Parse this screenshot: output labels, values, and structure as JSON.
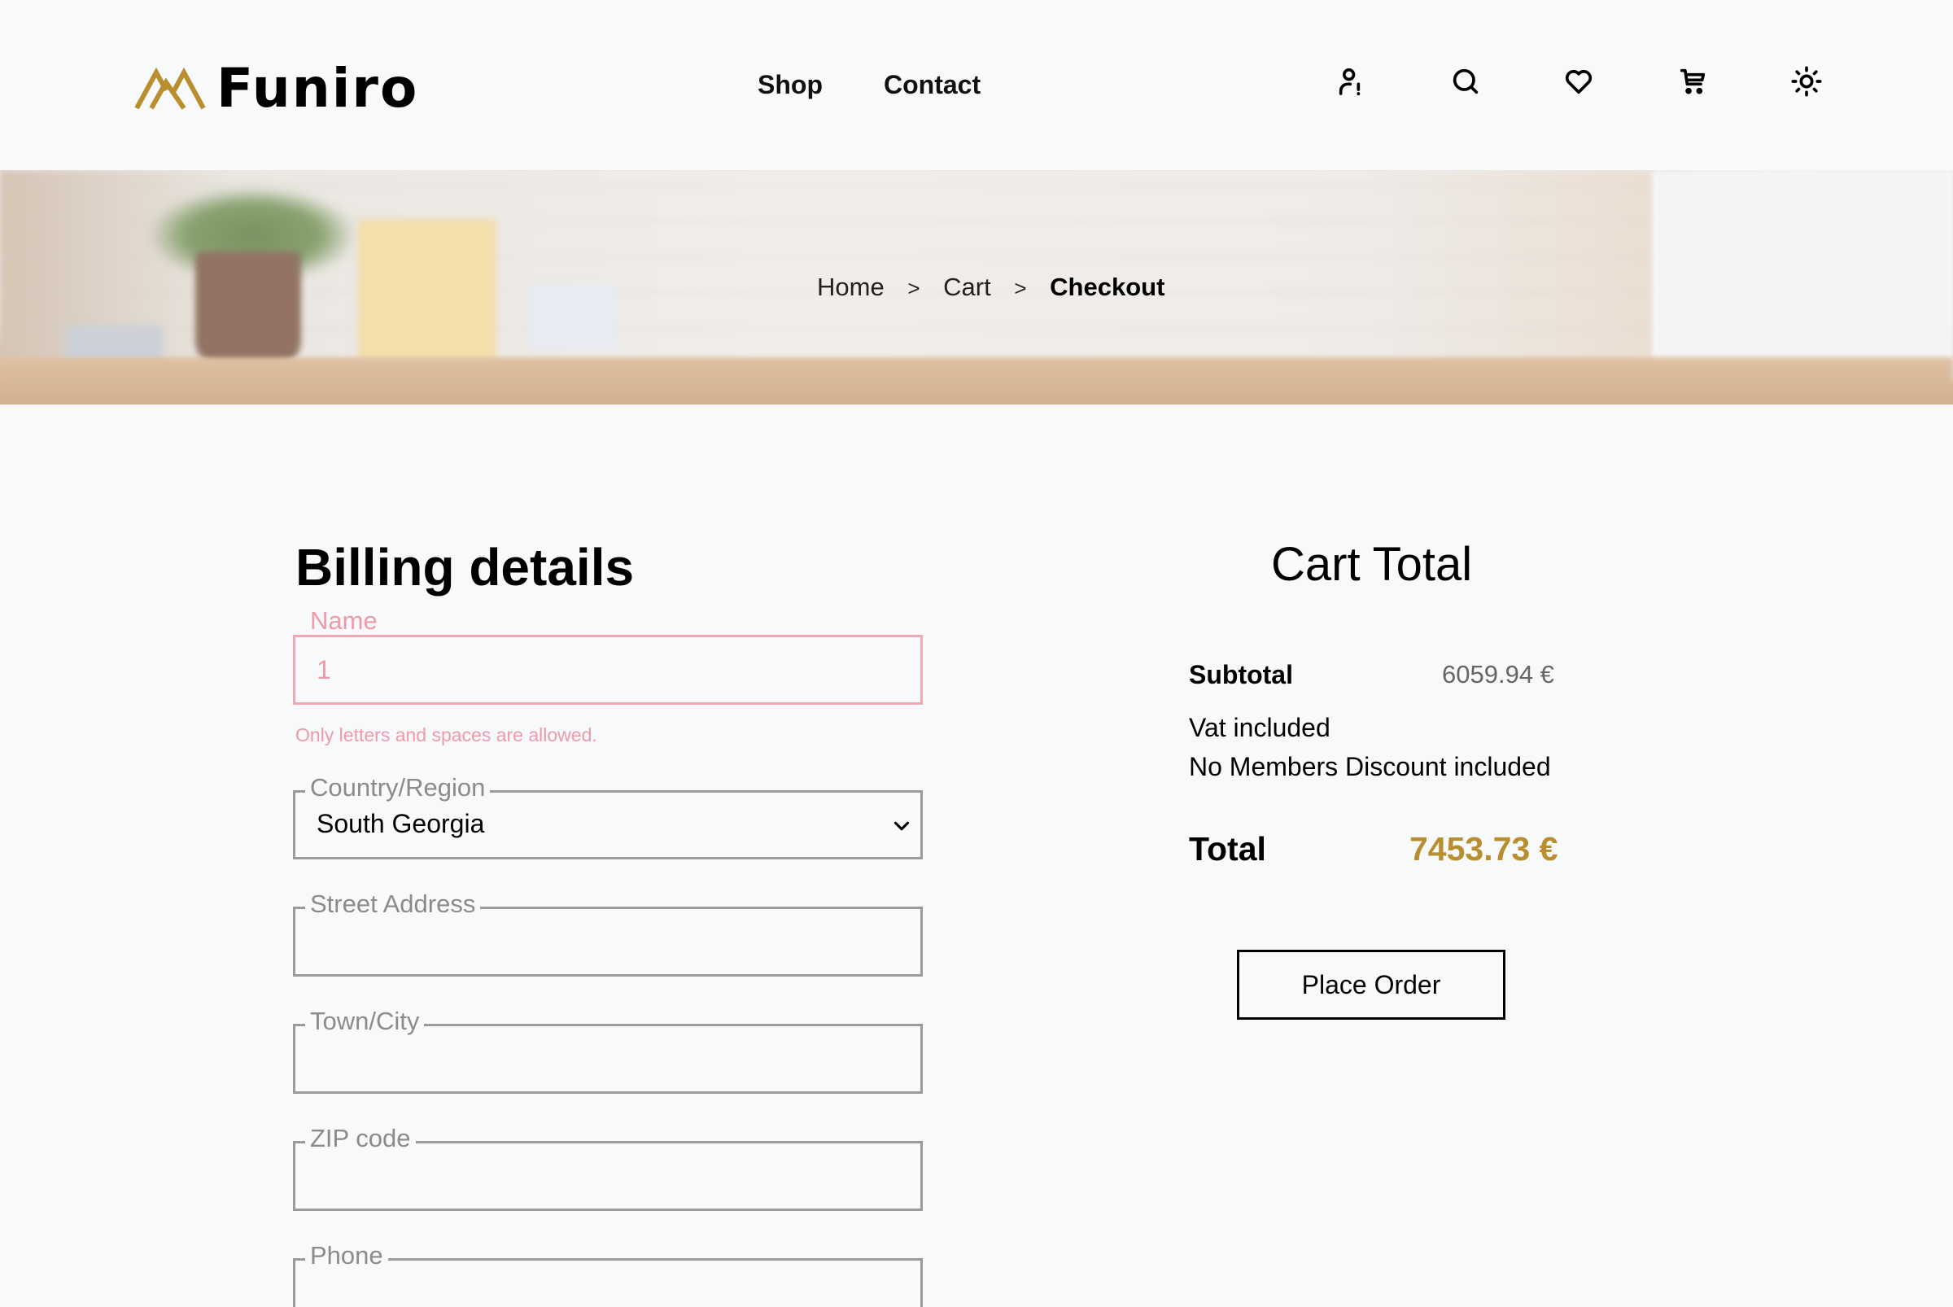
{
  "brand": {
    "name": "Funiro",
    "logo_color": "#b88e2f"
  },
  "nav": {
    "shop": "Shop",
    "contact": "Contact"
  },
  "header_icons": [
    "user-alert-icon",
    "search-icon",
    "heart-icon",
    "cart-icon",
    "sun-icon"
  ],
  "breadcrumb": {
    "home": "Home",
    "separator": ">",
    "cart": "Cart",
    "current": "Checkout"
  },
  "billing": {
    "title": "Billing details",
    "name": {
      "label": "Name",
      "value": "1",
      "error": "Only letters and spaces are allowed."
    },
    "country": {
      "label": "Country/Region",
      "value": "South Georgia"
    },
    "street": {
      "label": "Street Address",
      "value": ""
    },
    "town": {
      "label": "Town/City",
      "value": ""
    },
    "zip": {
      "label": "ZIP code",
      "value": ""
    },
    "phone": {
      "label": "Phone",
      "value": ""
    }
  },
  "cart_total": {
    "title": "Cart Total",
    "subtotal_label": "Subtotal",
    "subtotal_value": "6059.94 €",
    "vat_note": "Vat included",
    "discount_note": "No Members Discount included",
    "total_label": "Total",
    "total_value": "7453.73 €",
    "accent": "#b88e2f",
    "place_order": "Place Order"
  },
  "colors": {
    "error": "#ef9aa8",
    "background": "#f8f9fb"
  }
}
